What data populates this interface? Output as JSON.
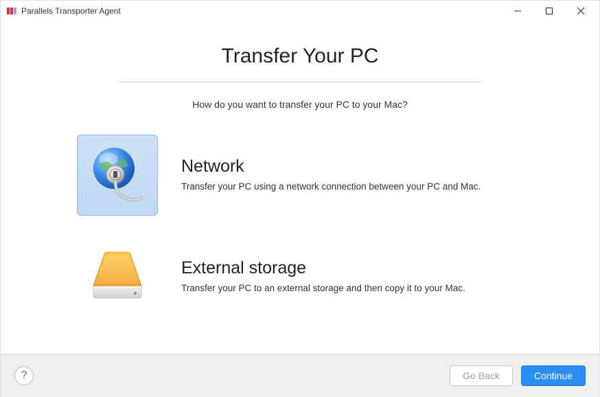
{
  "window": {
    "title": "Parallels Transporter Agent"
  },
  "page": {
    "title": "Transfer Your PC",
    "subtitle": "How do you want to transfer your PC to your Mac?"
  },
  "options": {
    "network": {
      "title": "Network",
      "description": "Transfer your PC using a network connection between your PC and Mac.",
      "selected": true
    },
    "external": {
      "title": "External storage",
      "description": "Transfer your PC to an external storage and then copy it to your Mac.",
      "selected": false
    }
  },
  "footer": {
    "help_label": "?",
    "back_label": "Go Back",
    "continue_label": "Continue"
  }
}
